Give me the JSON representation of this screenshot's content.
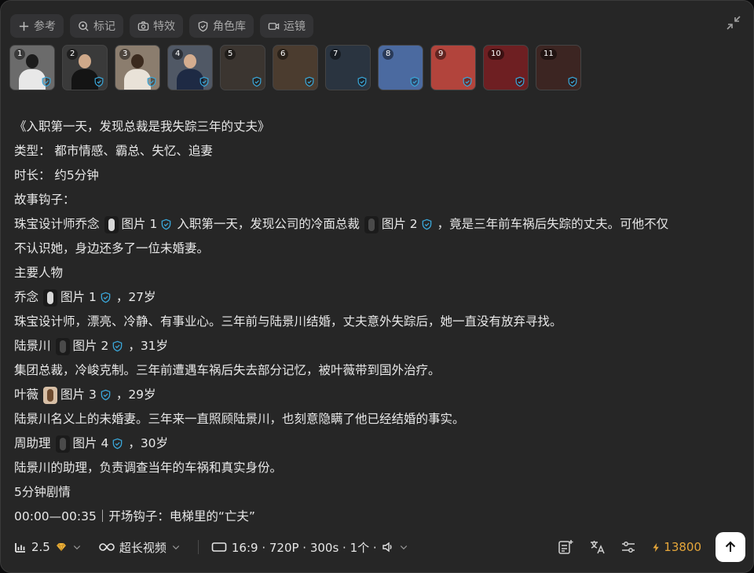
{
  "toolbar": {
    "items": [
      {
        "label": "参考",
        "icon": "plus-icon"
      },
      {
        "label": "标记",
        "icon": "target-icon"
      },
      {
        "label": "特效",
        "icon": "camera-icon"
      },
      {
        "label": "角色库",
        "icon": "shield-icon"
      },
      {
        "label": "运镜",
        "icon": "video-icon"
      }
    ]
  },
  "thumbnails": [
    {
      "num": "1",
      "bg": "#6b6b6b",
      "fig": "#e8e8e8",
      "head": "#1c1c1c"
    },
    {
      "num": "2",
      "bg": "#3a3a3a",
      "fig": "#141414",
      "head": "#cfa98a"
    },
    {
      "num": "3",
      "bg": "#8b7d6e",
      "fig": "#e9e2d8",
      "head": "#3b2a1e"
    },
    {
      "num": "4",
      "bg": "#505865",
      "fig": "#1e2a44",
      "head": "#d4ad8f"
    },
    {
      "num": "5",
      "bg": "#3b3530",
      "fig": "",
      "head": ""
    },
    {
      "num": "6",
      "bg": "#4b3c2f",
      "fig": "",
      "head": ""
    },
    {
      "num": "7",
      "bg": "#2a3440",
      "fig": "",
      "head": ""
    },
    {
      "num": "8",
      "bg": "#4b6aa0",
      "fig": "",
      "head": ""
    },
    {
      "num": "9",
      "bg": "#b2443c",
      "fig": "",
      "head": ""
    },
    {
      "num": "10",
      "bg": "#6e1f22",
      "fig": "",
      "head": ""
    },
    {
      "num": "11",
      "bg": "#3c2522",
      "fig": "",
      "head": ""
    }
  ],
  "content": {
    "title": "《入职第一天，发现总裁是我失踪三年的丈夫》",
    "genre": "类型： 都市情感、霸总、失忆、追妻",
    "duration": "时长： 约5分钟",
    "hook_label": "故事钩子：",
    "hook_a": "珠宝设计师乔念",
    "ref1": "图片 1",
    "hook_b": "入职第一天，发现公司的冷面总裁",
    "ref2": "图片 2",
    "hook_c": "，竟是三年前车祸后失踪的丈夫。可他不仅",
    "hook_d": "不认识她，身边还多了一位未婚妻。",
    "chars_label": "主要人物",
    "c1_name": "乔念",
    "c1_ref": "图片 1",
    "c1_age": "，27岁",
    "c1_desc": "珠宝设计师，漂亮、冷静、有事业心。三年前与陆景川结婚，丈夫意外失踪后，她一直没有放弃寻找。",
    "c2_name": "陆景川",
    "c2_ref": "图片 2",
    "c2_age": "，31岁",
    "c2_desc": "集团总裁，冷峻克制。三年前遭遇车祸后失去部分记忆，被叶薇带到国外治疗。",
    "c3_name": "叶薇",
    "c3_ref": "图片 3",
    "c3_age": "，29岁",
    "c3_desc": "陆景川名义上的未婚妻。三年来一直照顾陆景川，也刻意隐瞒了他已经结婚的事实。",
    "c4_name": "周助理",
    "c4_ref": "图片 4",
    "c4_age": "，30岁",
    "c4_desc": "陆景川的助理，负责调查当年的车祸和真实身份。",
    "plot_label": "5分钟剧情",
    "plot_first": "00:00—00:35｜开场钩子：电梯里的“亡夫”"
  },
  "bottom": {
    "model_version": "2.5",
    "mode": "超长视频",
    "params": "16:9 · 720P · 300s · 1个 ·",
    "credits": "13800"
  },
  "colors": {
    "panel": "#262626",
    "accent_shield": "#3aa6d8",
    "credits": "#e5a63a"
  }
}
